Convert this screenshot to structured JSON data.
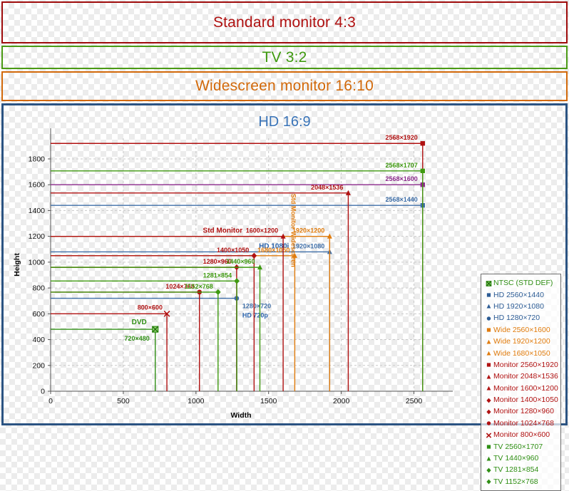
{
  "bands": [
    {
      "id": "standard",
      "label": "Standard monitor 4:3",
      "color": "#b01111",
      "border": "#9e0b0b"
    },
    {
      "id": "tv",
      "label": "TV 3:2",
      "color": "#3f9a10",
      "border": "#4a9a14"
    },
    {
      "id": "wide",
      "label": "Widescreen monitor 16:10",
      "color": "#d2690a",
      "border": "#d2690a"
    }
  ],
  "hd_panel": {
    "title": "HD 16:9",
    "border": "#2b5382",
    "title_color": "#3a74b8"
  },
  "chart_data": {
    "type": "scatter",
    "title": "HD 16:9",
    "xlabel": "Width",
    "ylabel": "Height",
    "xlim": [
      0,
      2620
    ],
    "ylim": [
      0,
      1960
    ],
    "xticks": [
      0,
      500,
      1000,
      1500,
      2000,
      2500
    ],
    "yticks": [
      0,
      200,
      400,
      600,
      800,
      1000,
      1200,
      1400,
      1600,
      1800
    ],
    "grid": true,
    "legend_position": "right",
    "points": [
      {
        "name": "NTSC (STD DEF)",
        "x": 720,
        "y": 480,
        "marker": "boxcross",
        "color": "#2f8f14",
        "label": "720×480",
        "label_side": "below-left",
        "extra": "DVD",
        "extra_color": "#2f8f14"
      },
      {
        "name": "HD 2560×1440",
        "x": 2560,
        "y": 1440,
        "marker": "square",
        "color": "#3f6fa8",
        "label": "2568×1440",
        "label_side": "left"
      },
      {
        "name": "HD 1920×1080",
        "x": 1920,
        "y": 1080,
        "marker": "triangle",
        "color": "#3f6fa8",
        "label": "1920×1080",
        "label_side": "left",
        "extra": "HD 1080i",
        "extra_color": "#2b64ad"
      },
      {
        "name": "HD 1280×720",
        "x": 1280,
        "y": 720,
        "marker": "circle",
        "color": "#3f6fa8",
        "label": "1280×720",
        "label_side": "below",
        "extra": "HD 720p",
        "extra_color": "#2b64ad"
      },
      {
        "name": "Wide 2560×1600",
        "x": 2560,
        "y": 1600,
        "marker": "square",
        "color": "#8d2a8d",
        "label": "2568×1600",
        "label_side": "left"
      },
      {
        "name": "Wide 1920×1200",
        "x": 1920,
        "y": 1200,
        "marker": "triangle",
        "color": "#e07b0c",
        "label": "1920×1200",
        "label_side": "left"
      },
      {
        "name": "Wide 1680×1050",
        "x": 1680,
        "y": 1050,
        "marker": "triangle",
        "color": "#e07b0c",
        "label": "1680×1050",
        "label_side": "left",
        "extra": "Std Monitor Widescreen",
        "extra_color": "#e07b0c",
        "extra_rotated": true
      },
      {
        "name": "Monitor 2560×1920",
        "x": 2560,
        "y": 1920,
        "marker": "square",
        "color": "#b01111",
        "label": "2568×1920",
        "label_side": "left"
      },
      {
        "name": "Monitor 2048×1536",
        "x": 2048,
        "y": 1536,
        "marker": "triangle",
        "color": "#b01111",
        "label": "2048×1536",
        "label_side": "left"
      },
      {
        "name": "Monitor 1600×1200",
        "x": 1600,
        "y": 1200,
        "marker": "triangle",
        "color": "#b01111",
        "label": "1600×1200",
        "label_side": "left",
        "extra": "Std Monitor",
        "extra_color": "#b01111"
      },
      {
        "name": "Monitor 1400×1050",
        "x": 1400,
        "y": 1050,
        "marker": "diamond",
        "color": "#b01111",
        "label": "1400×1050",
        "label_side": "left"
      },
      {
        "name": "Monitor 1280×960",
        "x": 1280,
        "y": 960,
        "marker": "diamond",
        "color": "#b01111",
        "label": "1280×960",
        "label_side": "left"
      },
      {
        "name": "Monitor 1024×768",
        "x": 1024,
        "y": 768,
        "marker": "circle",
        "color": "#b01111",
        "label": "1024×768",
        "label_side": "left"
      },
      {
        "name": "Monitor 800×600",
        "x": 800,
        "y": 600,
        "marker": "cross",
        "color": "#b01111",
        "label": "800×600",
        "label_side": "above-left"
      },
      {
        "name": "TV 2560×1707",
        "x": 2560,
        "y": 1707,
        "marker": "square",
        "color": "#3f9a10",
        "label": "2568×1707",
        "label_side": "left"
      },
      {
        "name": "TV 1440×960",
        "x": 1440,
        "y": 960,
        "marker": "triangle",
        "color": "#3f9a10",
        "label": "1440×960",
        "label_side": "left"
      },
      {
        "name": "TV 1281×854",
        "x": 1281,
        "y": 854,
        "marker": "diamond",
        "color": "#3f9a10",
        "label": "1281×854",
        "label_side": "left"
      },
      {
        "name": "TV 1152×768",
        "x": 1152,
        "y": 768,
        "marker": "diamond",
        "color": "#3f9a10",
        "label": "1152×768",
        "label_side": "left"
      }
    ]
  },
  "legend": {
    "items": [
      {
        "label": "NTSC (STD DEF)",
        "marker": "boxcross",
        "color": "#2f8f14"
      },
      {
        "label": "HD 2560×1440",
        "marker": "square",
        "color": "#2b5b94"
      },
      {
        "label": "HD 1920×1080",
        "marker": "triangle",
        "color": "#2b5b94"
      },
      {
        "label": "HD 1280×720",
        "marker": "circle",
        "color": "#2b5b94"
      },
      {
        "label": "Wide 2560×1600",
        "marker": "square",
        "color": "#e07b0c"
      },
      {
        "label": "Wide 1920×1200",
        "marker": "triangle",
        "color": "#e07b0c"
      },
      {
        "label": "Wide 1680×1050",
        "marker": "triangle",
        "color": "#e07b0c"
      },
      {
        "label": "Monitor 2560×1920",
        "marker": "square",
        "color": "#b01111"
      },
      {
        "label": "Monitor 2048×1536",
        "marker": "triangle",
        "color": "#b01111"
      },
      {
        "label": "Monitor 1600×1200",
        "marker": "triangle",
        "color": "#b01111"
      },
      {
        "label": "Monitor 1400×1050",
        "marker": "diamond",
        "color": "#b01111"
      },
      {
        "label": "Monitor 1280×960",
        "marker": "diamond",
        "color": "#b01111"
      },
      {
        "label": "Monitor 1024×768",
        "marker": "circle",
        "color": "#b01111"
      },
      {
        "label": "Monitor 800×600",
        "marker": "cross",
        "color": "#b01111"
      },
      {
        "label": "TV 2560×1707",
        "marker": "square",
        "color": "#2f8f14"
      },
      {
        "label": "TV 1440×960",
        "marker": "triangle",
        "color": "#2f8f14"
      },
      {
        "label": "TV 1281×854",
        "marker": "diamond",
        "color": "#2f8f14"
      },
      {
        "label": "TV 1152×768",
        "marker": "diamond",
        "color": "#2f8f14"
      }
    ]
  }
}
